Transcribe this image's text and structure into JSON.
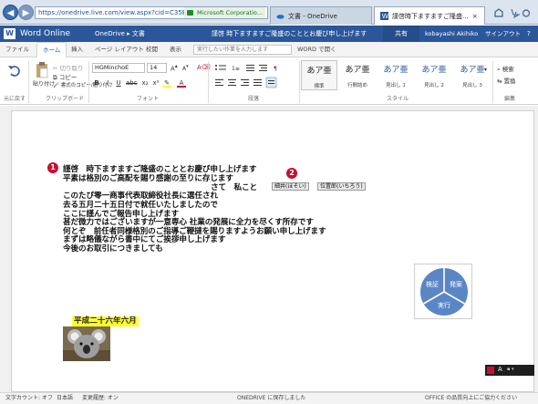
{
  "browser": {
    "url": "https://onedrive.live.com/view.aspx?cid=C35B",
    "security": "Microsoft Corporatio...",
    "tabs": [
      {
        "label": "文書 - OneDrive"
      },
      {
        "label": "謹啓時下ますますご隆盛..."
      }
    ]
  },
  "app": {
    "name": "Word Online",
    "breadcrumb": "OneDrive ▸ 文書",
    "doc_title": "謹啓 時下ますますご隆盛のこととお慶び申し上げます",
    "share": "共有",
    "user": "kobayashi Akihiko",
    "signout": "サインアウト"
  },
  "ribbon_tabs": {
    "file": "ファイル",
    "home": "ホーム",
    "insert": "挿入",
    "layout": "ページ レイアウト",
    "review": "校閲",
    "view": "表示",
    "tellme": "実行したい作業を入力します",
    "open_word": "WORD で開く"
  },
  "ribbon": {
    "undo": "元に戻す",
    "cut": "切り取り",
    "paste": "貼り付け",
    "copy": "コピー",
    "format_painter": "書式のコピー/貼り付け",
    "clipboard": "クリップボード",
    "font_name": "HGMinchoE",
    "font_size": "14",
    "font_group": "フォント",
    "paragraph_group": "段落",
    "styles_group": "スタイル",
    "editing_group": "編集",
    "find": "検索",
    "replace": "置換",
    "styles": [
      {
        "big": "あア亜",
        "name": "標準"
      },
      {
        "big": "あア亜",
        "name": "行間詰め"
      },
      {
        "big": "あア亜",
        "name": "見出し 1"
      },
      {
        "big": "あア亜",
        "name": "見出し 2"
      },
      {
        "big": "あア亜",
        "name": "見出し 3"
      }
    ]
  },
  "document": {
    "badge1": "1",
    "badge2": "2",
    "lines": [
      "謹啓　時下ますますご隆盛のこととお慶び申し上げます",
      "平素は格別のご高配を賜り感謝の至りに存じます",
      "さて　私こと",
      "このたび零一商事代表取締役社長に選任され",
      "去る五月二十五日付で就任いたしましたので",
      "ここに謹んでご報告申し上げます",
      "甚だ微力ではございますが一意専心 社業の発展に全力を尽くす所存です",
      "何とぞ　前任者同様格別のご指導ご鞭撻を賜りますようお願い申し上げます",
      "まずは略儀ながら書中にてご挨拶申し上げます",
      "今後のお取引につきましても"
    ],
    "field1": "細井(ほそい)",
    "field2": "位置郎(いちろう)",
    "date": "平成二十六年六月",
    "smartart": [
      "検証",
      "発案",
      "実行"
    ]
  },
  "status": {
    "word_count": "文字カウント: オフ",
    "language": "日本語",
    "track": "変更履歴: オン",
    "saved": "ONEDRIVE に保存しました",
    "improve": "OFFICE の品質向上にご協力ください"
  },
  "colors": {
    "word_blue": "#2b579a",
    "badge_red": "#c8102e",
    "highlight": "#ffff2b",
    "smartart_blue": "#5a86c6"
  }
}
